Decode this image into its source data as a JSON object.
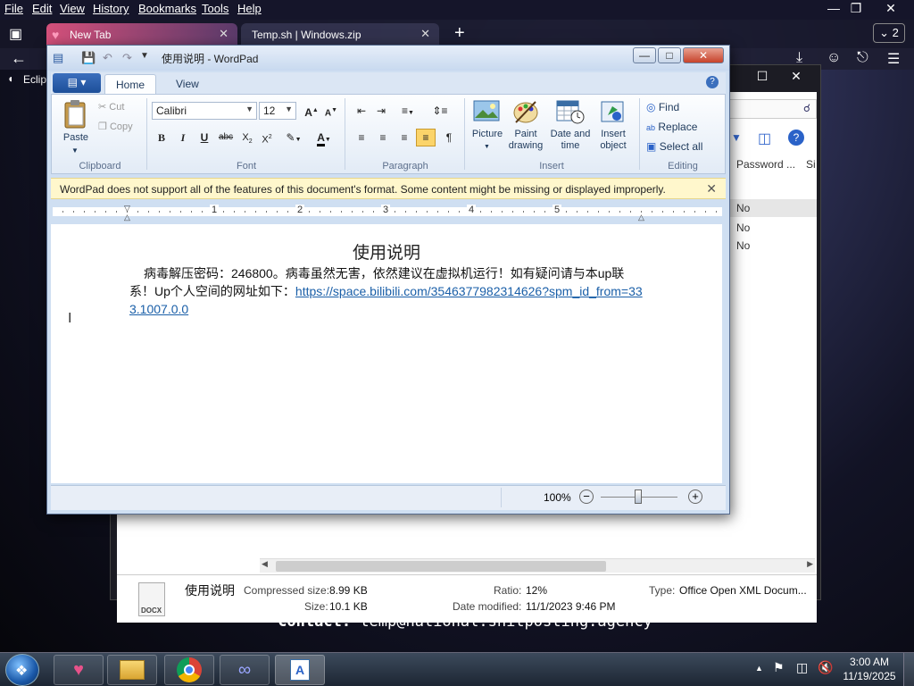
{
  "browser": {
    "menu": [
      "File",
      "Edit",
      "View",
      "History",
      "Bookmarks",
      "Tools",
      "Help"
    ],
    "tabs": [
      {
        "label": "New Tab"
      },
      {
        "label": "Temp.sh | Windows.zip"
      }
    ],
    "tab_count": "2",
    "bookmark_partial": "Eclip"
  },
  "archive": {
    "column_password": "Password ...",
    "column_next": "Si",
    "rows": [
      "No",
      "No",
      "No"
    ],
    "file_name": "使用说明",
    "file_type_badge": "DOCX",
    "compressed_label": "Compressed size:",
    "compressed_value": "8.99 KB",
    "size_label": "Size:",
    "size_value": "10.1 KB",
    "ratio_label": "Ratio:",
    "ratio_value": "12%",
    "modified_label": "Date modified:",
    "modified_value": "11/1/2023 9:46 PM",
    "type_label": "Type:",
    "type_value": "Office Open XML Docum..."
  },
  "wordpad": {
    "title": "使用说明 - WordPad",
    "tabs": [
      "Home",
      "View"
    ],
    "clipboard": {
      "paste": "Paste",
      "cut": "Cut",
      "copy": "Copy",
      "group": "Clipboard"
    },
    "font": {
      "family": "Calibri",
      "size": "12",
      "group": "Font"
    },
    "paragraph": {
      "group": "Paragraph"
    },
    "insert": {
      "picture": "Picture",
      "paint_1": "Paint",
      "paint_2": "drawing",
      "datetime_1": "Date and",
      "datetime_2": "time",
      "object_1": "Insert",
      "object_2": "object",
      "group": "Insert"
    },
    "editing": {
      "find": "Find",
      "replace": "Replace",
      "select_all": "Select all",
      "group": "Editing"
    },
    "infobar": "WordPad does not support all of the features of this document's format. Some content might be missing or displayed improperly.",
    "ruler_numbers": [
      "1",
      "2",
      "3",
      "4",
      "5"
    ],
    "doc_title": "使用说明",
    "doc_text": "病毒解压密码：246800。病毒虽然无害，依然建议在虚拟机运行！如有疑问请与本up联系！Up个人空间的网址如下：",
    "doc_link": "https://space.bilibili.com/3546377982314626?spm_id_from=333.1007.0.0",
    "zoom": "100%"
  },
  "contact": {
    "label": "Contact:",
    "email": "temp@national.shitposting.agency"
  },
  "taskbar": {
    "time": "3:00 AM",
    "date": "11/19/2025"
  },
  "colors": {
    "accent": "#1d4f99",
    "infobar": "#fff7cc",
    "link": "#1a5fa8",
    "tab_pink": "#d4507a"
  }
}
